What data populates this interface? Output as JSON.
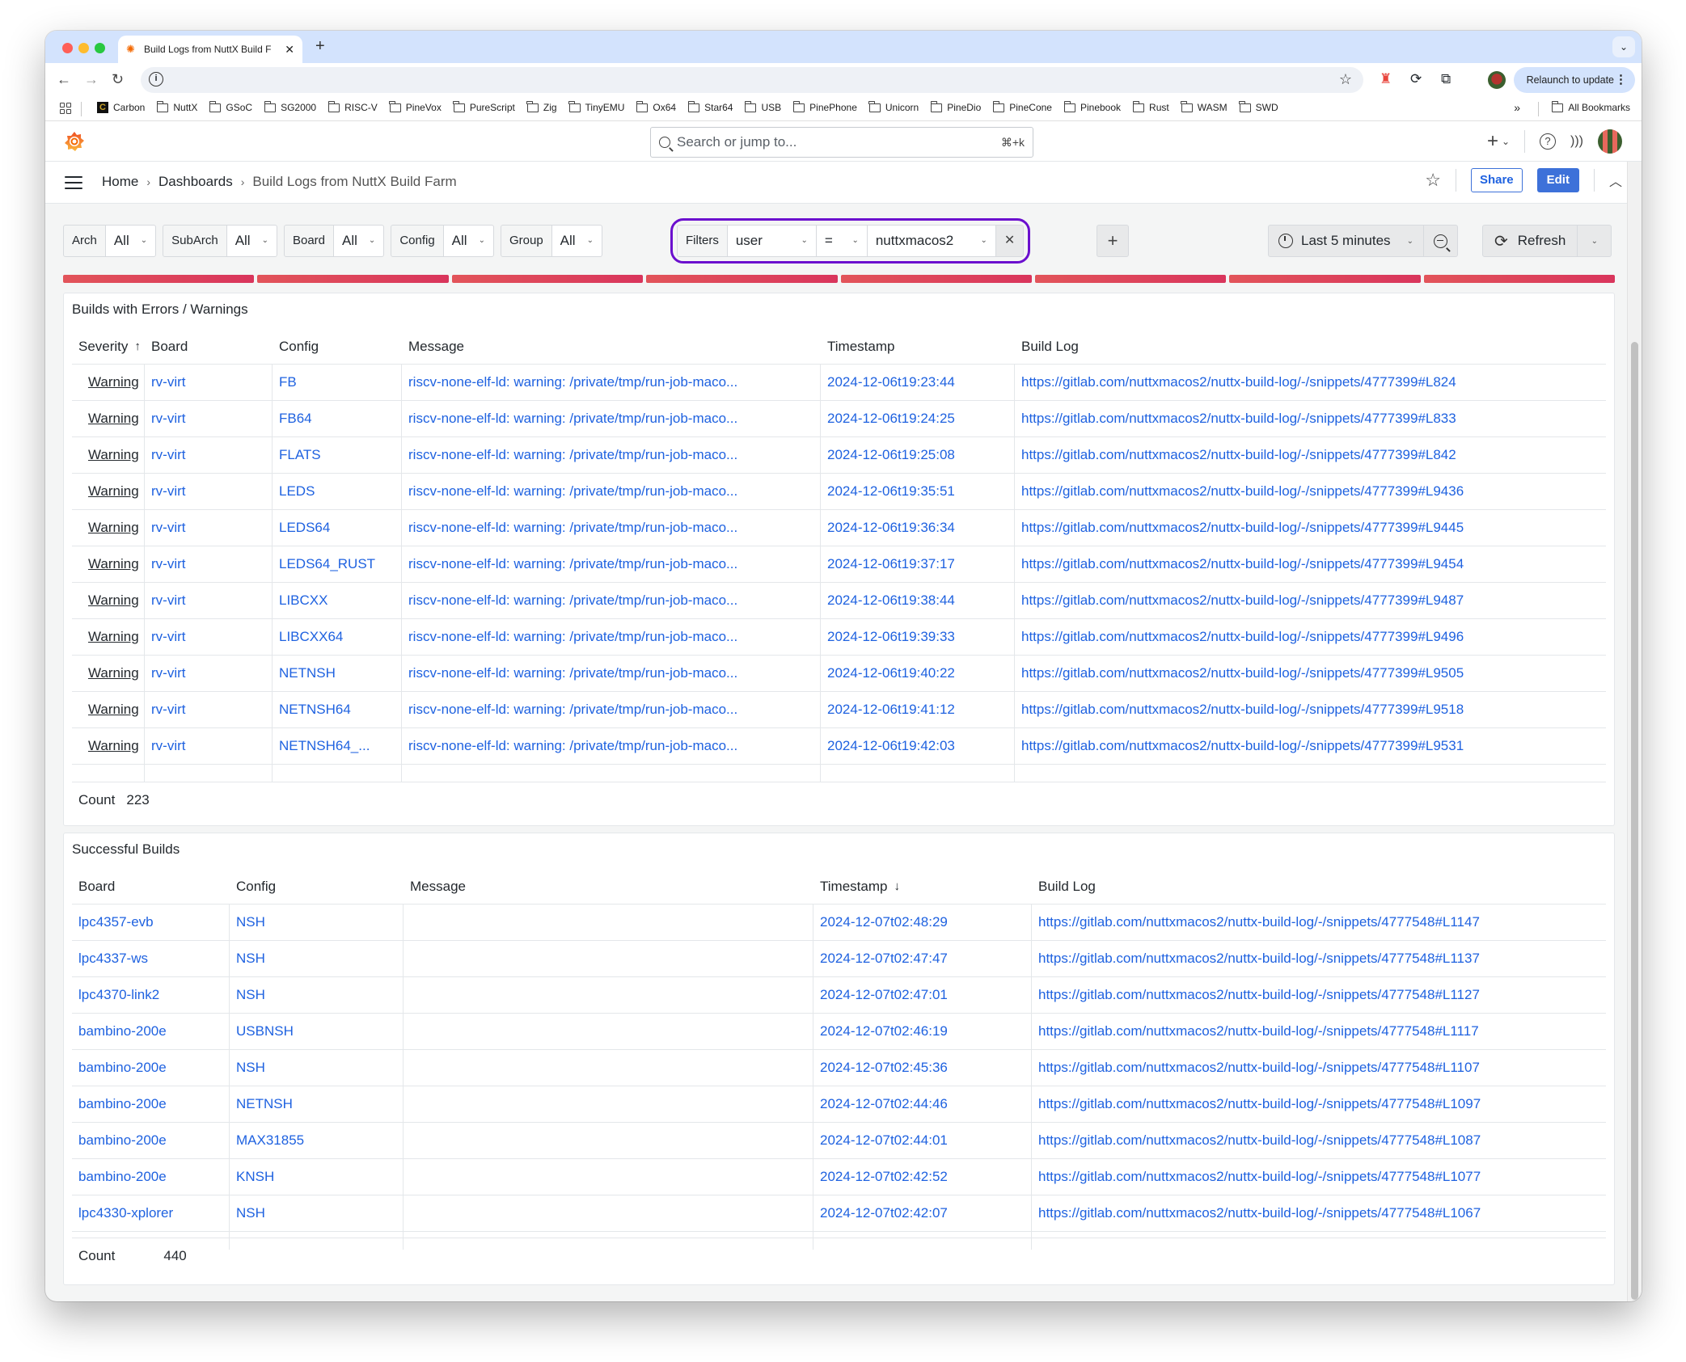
{
  "browser": {
    "tab_title": "Build Logs from NuttX Build F",
    "relaunch_label": "Relaunch to update",
    "bookmarks": [
      "Carbon",
      "NuttX",
      "GSoC",
      "SG2000",
      "RISC-V",
      "PineVox",
      "PureScript",
      "Zig",
      "TinyEMU",
      "Ox64",
      "Star64",
      "USB",
      "PinePhone",
      "Unicorn",
      "PineDio",
      "PineCone",
      "Pinebook",
      "Rust",
      "WASM",
      "SWD"
    ],
    "all_bookmarks_label": "All Bookmarks"
  },
  "grafana": {
    "search_placeholder": "Search or jump to...",
    "search_shortcut": "⌘+k",
    "breadcrumb": [
      "Home",
      "Dashboards",
      "Build Logs from NuttX Build Farm"
    ],
    "share_label": "Share",
    "edit_label": "Edit"
  },
  "variables": [
    {
      "label": "Arch",
      "value": "All"
    },
    {
      "label": "SubArch",
      "value": "All"
    },
    {
      "label": "Board",
      "value": "All"
    },
    {
      "label": "Config",
      "value": "All"
    },
    {
      "label": "Group",
      "value": "All"
    }
  ],
  "filters": {
    "label": "Filters",
    "key": "user",
    "operator": "=",
    "value": "nuttxmacos2"
  },
  "time_range": "Last 5 minutes",
  "refresh_label": "Refresh",
  "errors_panel": {
    "title": "Builds with Errors / Warnings",
    "columns": [
      "Severity",
      "Board",
      "Config",
      "Message",
      "Timestamp",
      "Build Log"
    ],
    "sort_indicator": "↑",
    "rows": [
      {
        "severity": "Warning",
        "board": "rv-virt",
        "config": "FB",
        "message": "riscv-none-elf-ld: warning: /private/tmp/run-job-maco...",
        "timestamp": "2024-12-06t19:23:44",
        "log": "https://gitlab.com/nuttxmacos2/nuttx-build-log/-/snippets/4777399#L824"
      },
      {
        "severity": "Warning",
        "board": "rv-virt",
        "config": "FB64",
        "message": "riscv-none-elf-ld: warning: /private/tmp/run-job-maco...",
        "timestamp": "2024-12-06t19:24:25",
        "log": "https://gitlab.com/nuttxmacos2/nuttx-build-log/-/snippets/4777399#L833"
      },
      {
        "severity": "Warning",
        "board": "rv-virt",
        "config": "FLATS",
        "message": "riscv-none-elf-ld: warning: /private/tmp/run-job-maco...",
        "timestamp": "2024-12-06t19:25:08",
        "log": "https://gitlab.com/nuttxmacos2/nuttx-build-log/-/snippets/4777399#L842"
      },
      {
        "severity": "Warning",
        "board": "rv-virt",
        "config": "LEDS",
        "message": "riscv-none-elf-ld: warning: /private/tmp/run-job-maco...",
        "timestamp": "2024-12-06t19:35:51",
        "log": "https://gitlab.com/nuttxmacos2/nuttx-build-log/-/snippets/4777399#L9436"
      },
      {
        "severity": "Warning",
        "board": "rv-virt",
        "config": "LEDS64",
        "message": "riscv-none-elf-ld: warning: /private/tmp/run-job-maco...",
        "timestamp": "2024-12-06t19:36:34",
        "log": "https://gitlab.com/nuttxmacos2/nuttx-build-log/-/snippets/4777399#L9445"
      },
      {
        "severity": "Warning",
        "board": "rv-virt",
        "config": "LEDS64_RUST",
        "message": "riscv-none-elf-ld: warning: /private/tmp/run-job-maco...",
        "timestamp": "2024-12-06t19:37:17",
        "log": "https://gitlab.com/nuttxmacos2/nuttx-build-log/-/snippets/4777399#L9454"
      },
      {
        "severity": "Warning",
        "board": "rv-virt",
        "config": "LIBCXX",
        "message": "riscv-none-elf-ld: warning: /private/tmp/run-job-maco...",
        "timestamp": "2024-12-06t19:38:44",
        "log": "https://gitlab.com/nuttxmacos2/nuttx-build-log/-/snippets/4777399#L9487"
      },
      {
        "severity": "Warning",
        "board": "rv-virt",
        "config": "LIBCXX64",
        "message": "riscv-none-elf-ld: warning: /private/tmp/run-job-maco...",
        "timestamp": "2024-12-06t19:39:33",
        "log": "https://gitlab.com/nuttxmacos2/nuttx-build-log/-/snippets/4777399#L9496"
      },
      {
        "severity": "Warning",
        "board": "rv-virt",
        "config": "NETNSH",
        "message": "riscv-none-elf-ld: warning: /private/tmp/run-job-maco...",
        "timestamp": "2024-12-06t19:40:22",
        "log": "https://gitlab.com/nuttxmacos2/nuttx-build-log/-/snippets/4777399#L9505"
      },
      {
        "severity": "Warning",
        "board": "rv-virt",
        "config": "NETNSH64",
        "message": "riscv-none-elf-ld: warning: /private/tmp/run-job-maco...",
        "timestamp": "2024-12-06t19:41:12",
        "log": "https://gitlab.com/nuttxmacos2/nuttx-build-log/-/snippets/4777399#L9518"
      },
      {
        "severity": "Warning",
        "board": "rv-virt",
        "config": "NETNSH64_...",
        "message": "riscv-none-elf-ld: warning: /private/tmp/run-job-maco...",
        "timestamp": "2024-12-06t19:42:03",
        "log": "https://gitlab.com/nuttxmacos2/nuttx-build-log/-/snippets/4777399#L9531"
      }
    ],
    "count_label": "Count",
    "count_value": "223"
  },
  "success_panel": {
    "title": "Successful Builds",
    "columns": [
      "Board",
      "Config",
      "Message",
      "Timestamp",
      "Build Log"
    ],
    "sort_indicator": "↓",
    "rows": [
      {
        "board": "lpc4357-evb",
        "config": "NSH",
        "message": "",
        "timestamp": "2024-12-07t02:48:29",
        "log": "https://gitlab.com/nuttxmacos2/nuttx-build-log/-/snippets/4777548#L1147"
      },
      {
        "board": "lpc4337-ws",
        "config": "NSH",
        "message": "",
        "timestamp": "2024-12-07t02:47:47",
        "log": "https://gitlab.com/nuttxmacos2/nuttx-build-log/-/snippets/4777548#L1137"
      },
      {
        "board": "lpc4370-link2",
        "config": "NSH",
        "message": "",
        "timestamp": "2024-12-07t02:47:01",
        "log": "https://gitlab.com/nuttxmacos2/nuttx-build-log/-/snippets/4777548#L1127"
      },
      {
        "board": "bambino-200e",
        "config": "USBNSH",
        "message": "",
        "timestamp": "2024-12-07t02:46:19",
        "log": "https://gitlab.com/nuttxmacos2/nuttx-build-log/-/snippets/4777548#L1117"
      },
      {
        "board": "bambino-200e",
        "config": "NSH",
        "message": "",
        "timestamp": "2024-12-07t02:45:36",
        "log": "https://gitlab.com/nuttxmacos2/nuttx-build-log/-/snippets/4777548#L1107"
      },
      {
        "board": "bambino-200e",
        "config": "NETNSH",
        "message": "",
        "timestamp": "2024-12-07t02:44:46",
        "log": "https://gitlab.com/nuttxmacos2/nuttx-build-log/-/snippets/4777548#L1097"
      },
      {
        "board": "bambino-200e",
        "config": "MAX31855",
        "message": "",
        "timestamp": "2024-12-07t02:44:01",
        "log": "https://gitlab.com/nuttxmacos2/nuttx-build-log/-/snippets/4777548#L1087"
      },
      {
        "board": "bambino-200e",
        "config": "KNSH",
        "message": "",
        "timestamp": "2024-12-07t02:42:52",
        "log": "https://gitlab.com/nuttxmacos2/nuttx-build-log/-/snippets/4777548#L1077"
      },
      {
        "board": "lpc4330-xplorer",
        "config": "NSH",
        "message": "",
        "timestamp": "2024-12-07t02:42:07",
        "log": "https://gitlab.com/nuttxmacos2/nuttx-build-log/-/snippets/4777548#L1067"
      }
    ],
    "count_label": "Count",
    "count_value": "440"
  }
}
